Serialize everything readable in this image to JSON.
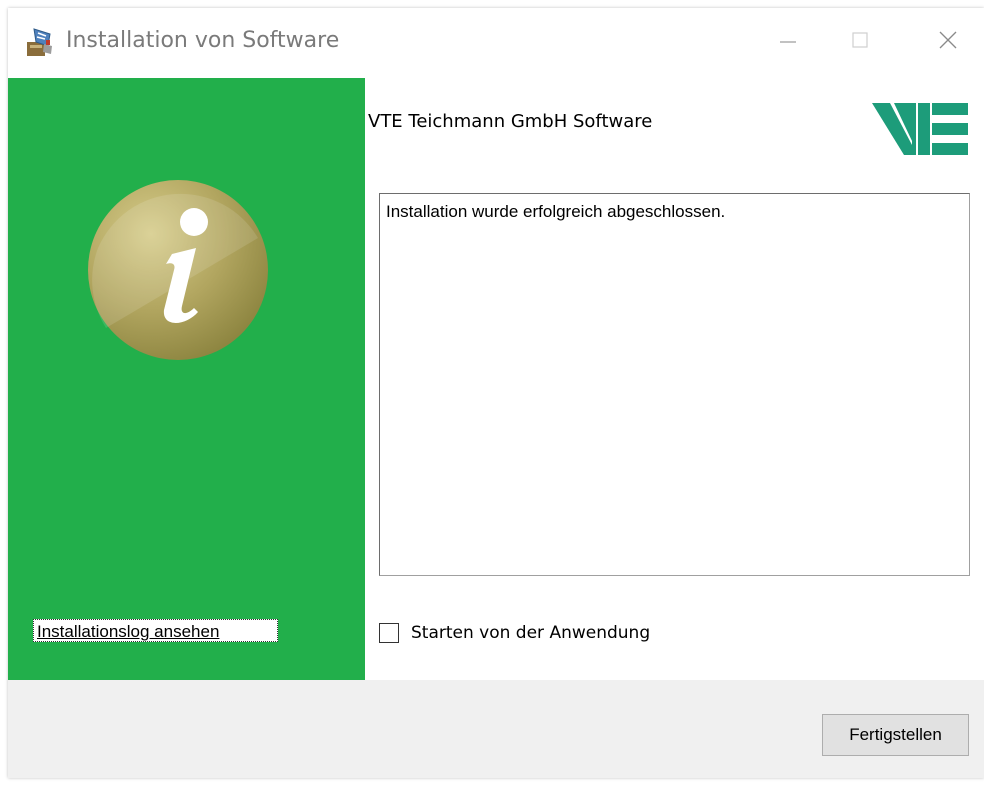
{
  "window": {
    "title": "Installation von Software",
    "controls": {
      "minimize": "minimize",
      "maximize": "maximize",
      "close": "close"
    }
  },
  "sidebar": {
    "icon": "info-icon",
    "log_link_label": "Installationslog ansehen",
    "background_color": "#22af4b"
  },
  "header": {
    "title": "VTE Teichmann GmbH Software",
    "logo": "VTE"
  },
  "main": {
    "message": "Installation wurde erfolgreich abgeschlossen.",
    "launch_checkbox": {
      "label": "Starten von der Anwendung",
      "checked": false
    }
  },
  "footer": {
    "finish_label": "Fertigstellen"
  }
}
